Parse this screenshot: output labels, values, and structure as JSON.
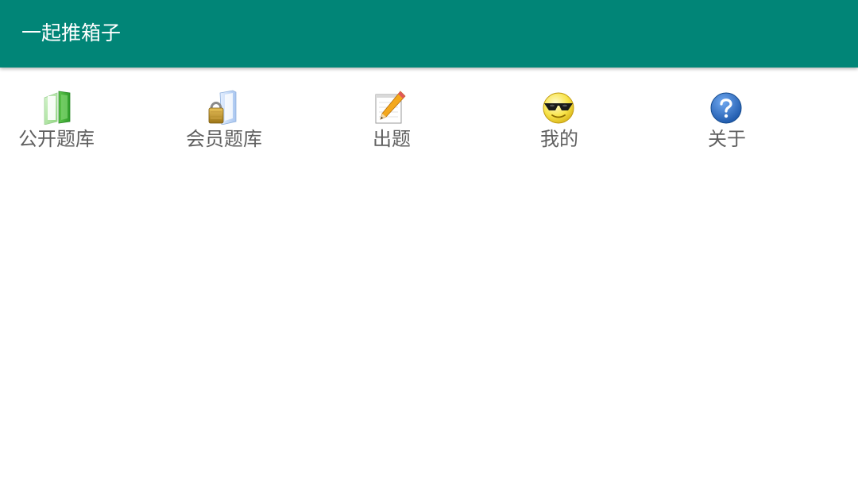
{
  "app_bar": {
    "title": "一起推箱子",
    "color": "#018577"
  },
  "menu": {
    "items": [
      {
        "label": "公开题库",
        "icon": "green-folder-icon"
      },
      {
        "label": "会员题库",
        "icon": "locked-folder-icon"
      },
      {
        "label": "出题",
        "icon": "notepad-pencil-icon"
      },
      {
        "label": "我的",
        "icon": "sunglasses-smiley-icon"
      },
      {
        "label": "关于",
        "icon": "help-question-icon"
      }
    ]
  }
}
